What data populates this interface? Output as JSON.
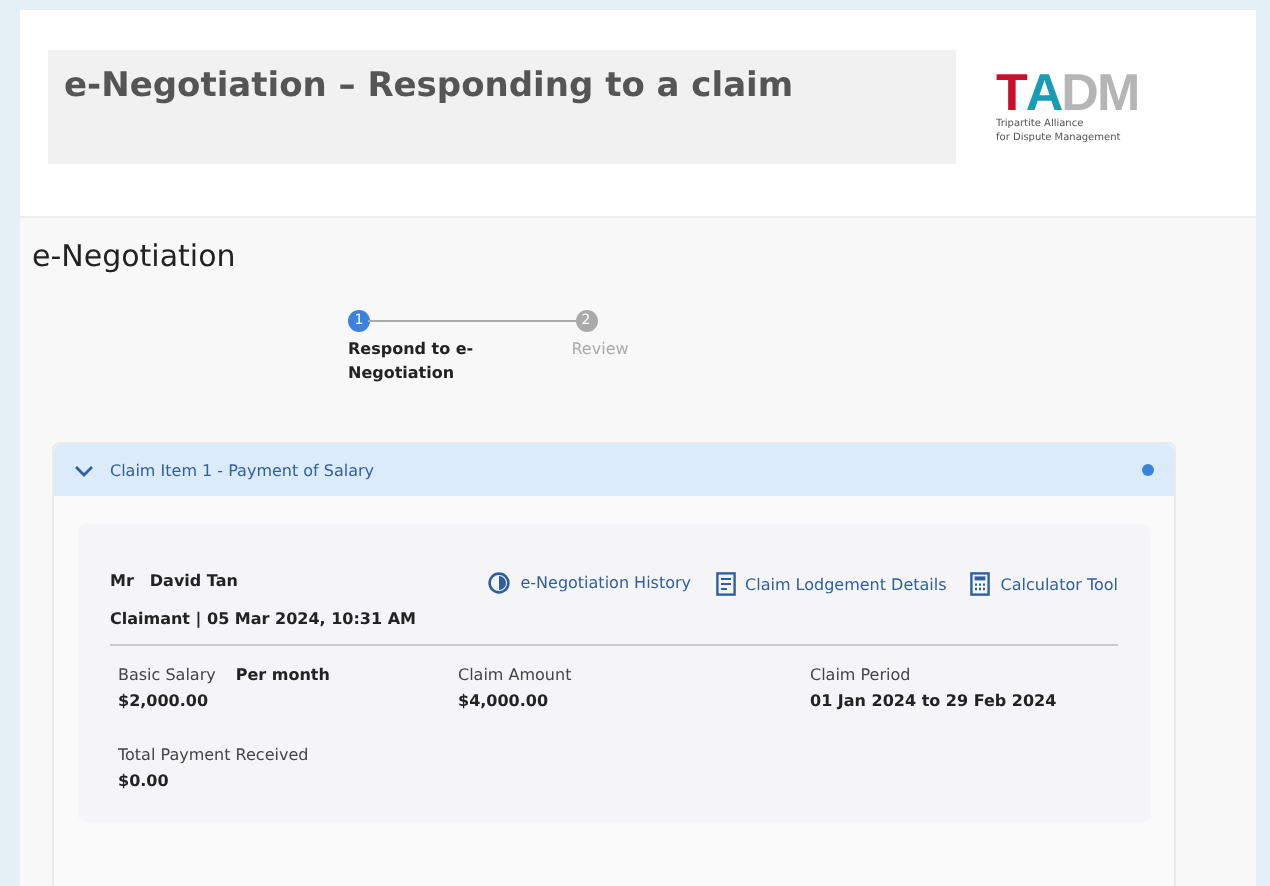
{
  "header": {
    "title": "e-Negotiation – Responding to a claim",
    "logo": {
      "letters": [
        {
          "text": "T",
          "color": "#c8102e"
        },
        {
          "text": "A",
          "color": "#1a9bb5"
        },
        {
          "text": "DM",
          "color": "#b5b5b5"
        }
      ],
      "tagline": [
        "Tripartite Alliance",
        "for Dispute Management"
      ]
    }
  },
  "page_title": "e-Negotiation",
  "steps": [
    {
      "number": "1",
      "label": "Respond to e-Negotiation",
      "selected": true
    },
    {
      "number": "2",
      "label": "Review",
      "selected": false
    }
  ],
  "claim_item": {
    "title": "Claim Item 1 - Payment of Salary",
    "expanded": true,
    "status_dot": true,
    "salutation": "Mr",
    "name": "David Tan",
    "subtitle": "Claimant | 05 Mar 2024, 10:31 AM",
    "links": [
      {
        "kind": "history",
        "label": "e-Negotiation History"
      },
      {
        "kind": "document",
        "label": "Claim Lodgement Details"
      },
      {
        "kind": "calculator",
        "label": "Calculator Tool"
      }
    ],
    "fields": [
      {
        "label": "Basic Salary",
        "note": "Per month",
        "value": "$2,000.00"
      },
      {
        "label": "Claim Amount",
        "value": "$4,000.00"
      },
      {
        "label": "Claim Period",
        "value": "01 Jan 2024 to 29 Feb 2024"
      },
      {
        "label": "Total Payment Received",
        "value": "$0.00"
      }
    ]
  }
}
